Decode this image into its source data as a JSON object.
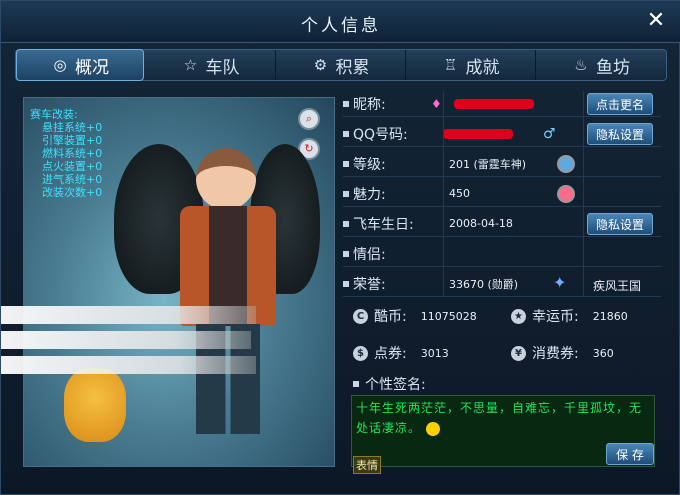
{
  "window": {
    "title": "个人信息",
    "close_label": "✕"
  },
  "tabs": [
    {
      "label": "概况",
      "icon": "target-icon",
      "glyph": "◎"
    },
    {
      "label": "车队",
      "icon": "star-icon",
      "glyph": "☆"
    },
    {
      "label": "积累",
      "icon": "gear-icon",
      "glyph": "⚙"
    },
    {
      "label": "成就",
      "icon": "medal-icon",
      "glyph": "♖"
    },
    {
      "label": "鱼坊",
      "icon": "fish-icon",
      "glyph": "♨"
    }
  ],
  "mods": {
    "heading": "赛车改装:",
    "items": [
      "悬挂系统+0",
      "引擎装置+0",
      "燃料系统+0",
      "点火装置+0",
      "进气系统+0",
      "改装次数+0"
    ]
  },
  "profile": {
    "nickname_label": "昵称:",
    "rename_button": "点击更名",
    "qq_label": "QQ号码:",
    "privacy_button": "隐私设置",
    "level_label": "等级:",
    "level_value": "201 (雷霆车神)",
    "charm_label": "魅力:",
    "charm_value": "450",
    "birthday_label": "飞车生日:",
    "birthday_value": "2008-04-18",
    "privacy_button_2": "隐私设置",
    "partner_label": "情侣:",
    "honor_label": "荣誉:",
    "honor_value": "33670 (勋爵)",
    "guild_value": "疾风王国"
  },
  "currency": {
    "coolcoin_label": "酷币:",
    "coolcoin_value": "11075028",
    "luckycoin_label": "幸运币:",
    "luckycoin_value": "21860",
    "voucher_label": "点券:",
    "voucher_value": "3013",
    "consume_label": "消费券:",
    "consume_value": "360"
  },
  "signature": {
    "label": "个性签名:",
    "text": "十年生死两茫茫，不思量，自难忘，千里孤坟，无处话凄凉。",
    "save_button": "保 存",
    "emoji_button": "表情"
  },
  "colors": {
    "accent": "#4a86b8",
    "mod_text": "#3ee0ff",
    "signature_text": "#22e35a"
  }
}
